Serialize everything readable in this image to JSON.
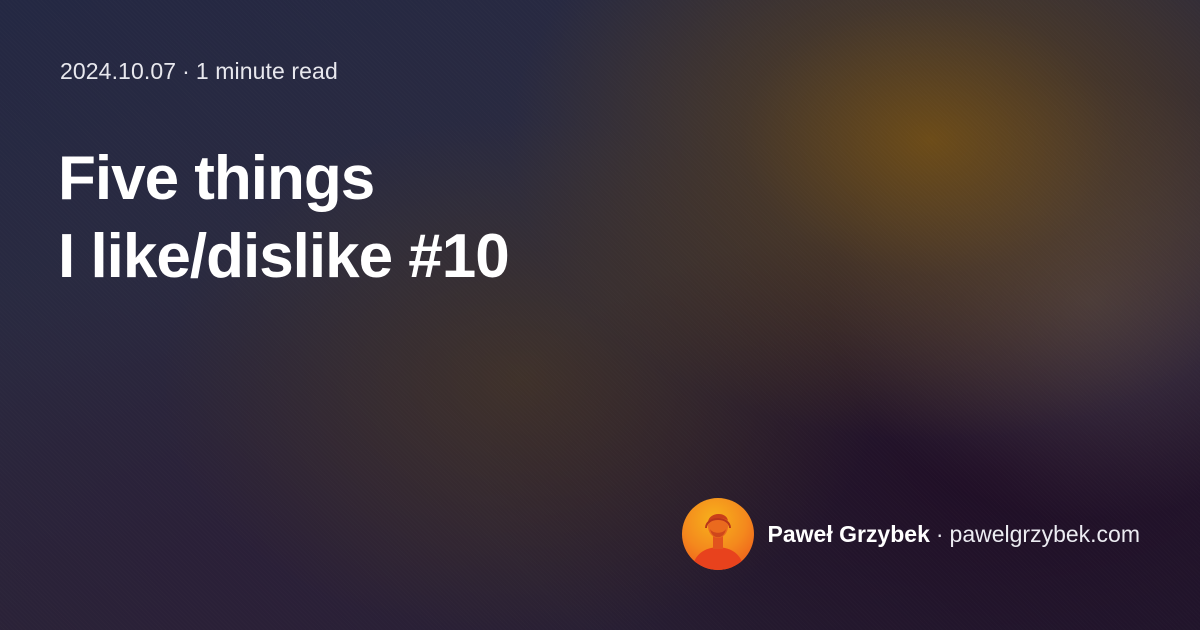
{
  "meta": {
    "date": "2024.10.07",
    "separator": "·",
    "read_time": "1 minute read"
  },
  "title": {
    "line1": "Five things",
    "line2": "I like/dislike #10"
  },
  "author": {
    "name": "Paweł Grzybek",
    "separator": "·",
    "site": "pawelgrzybek.com",
    "avatar_icon": "author-portrait"
  },
  "colors": {
    "text": "#ffffff",
    "avatar_orange": "#f05a1e",
    "avatar_yellow": "#f6b11c"
  }
}
